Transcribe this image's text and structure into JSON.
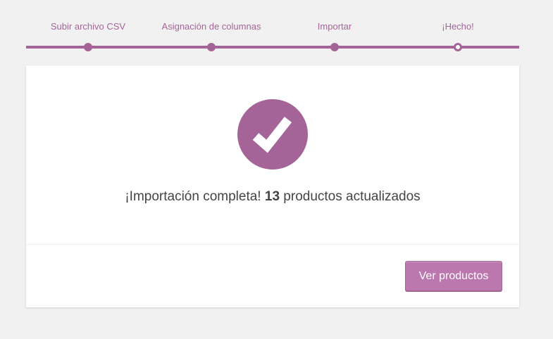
{
  "stepper": {
    "steps": [
      {
        "label": "Subir archivo CSV",
        "state": "done"
      },
      {
        "label": "Asignación de columnas",
        "state": "done"
      },
      {
        "label": "Importar",
        "state": "done"
      },
      {
        "label": "¡Hecho!",
        "state": "current"
      }
    ]
  },
  "result": {
    "icon": "checkmark-icon",
    "message_prefix": "¡Importación completa!",
    "count": "13",
    "message_suffix": "productos actualizados"
  },
  "footer": {
    "view_products_label": "Ver productos"
  },
  "colors": {
    "accent": "#a46497",
    "button": "#bb77ae",
    "background": "#f1f1f1"
  }
}
